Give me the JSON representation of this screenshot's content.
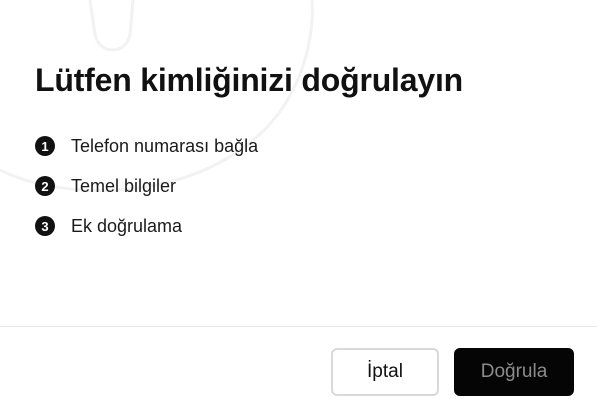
{
  "dialog": {
    "title": "Lütfen kimliğinizi doğrulayın",
    "background_art": "faint-phone-outline-icon"
  },
  "steps": [
    {
      "number": "1",
      "label": "Telefon numarası bağla"
    },
    {
      "number": "2",
      "label": "Temel bilgiler"
    },
    {
      "number": "3",
      "label": "Ek doğrulama"
    }
  ],
  "footer": {
    "cancel_label": "İptal",
    "verify_label": "Doğrula",
    "verify_enabled": false
  },
  "colors": {
    "primary_button_bg": "#050505",
    "disabled_text": "#8c8c8c",
    "text": "#111111"
  }
}
